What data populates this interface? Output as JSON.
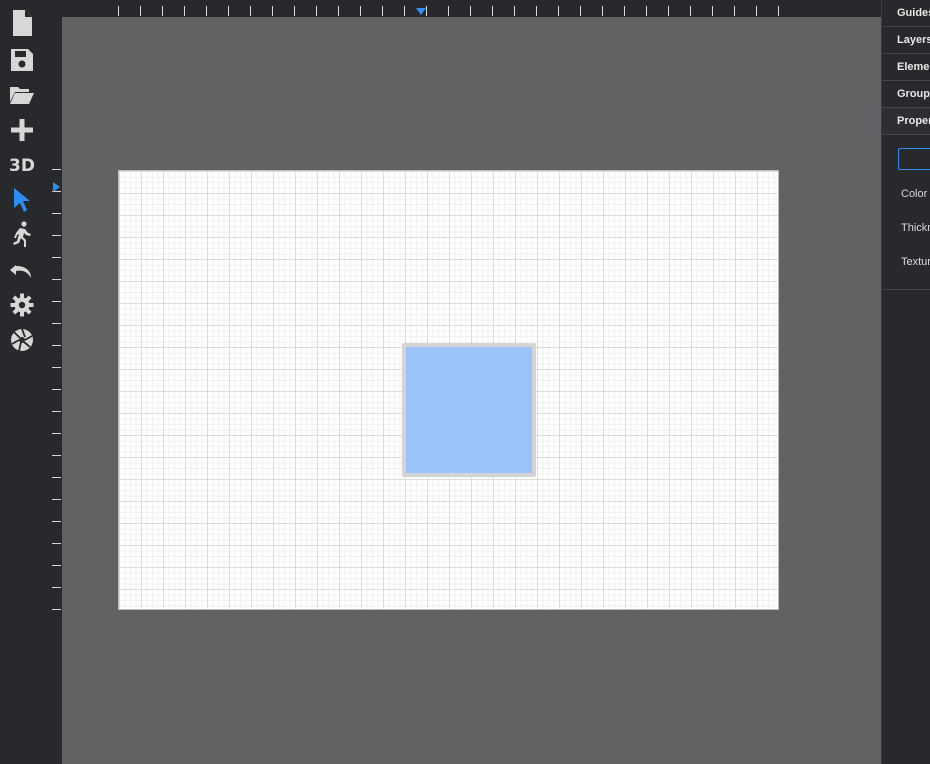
{
  "toolbar": {
    "tools": [
      {
        "name": "new-file-icon",
        "label": ""
      },
      {
        "name": "save-icon",
        "label": ""
      },
      {
        "name": "open-folder-icon",
        "label": ""
      },
      {
        "name": "add-icon",
        "label": ""
      },
      {
        "name": "3d-view-button",
        "label": "3D"
      },
      {
        "name": "select-pointer-icon",
        "label": ""
      },
      {
        "name": "walk-mode-icon",
        "label": ""
      },
      {
        "name": "undo-icon",
        "label": ""
      },
      {
        "name": "settings-gear-icon",
        "label": ""
      },
      {
        "name": "camera-aperture-icon",
        "label": ""
      }
    ],
    "active_tool": "select-pointer-icon",
    "accent_color": "#2d8ef0"
  },
  "canvas": {
    "room": {
      "label": "",
      "fill_color": "#9ac3f8"
    }
  },
  "panel": {
    "sections": {
      "guides": "Guides",
      "layers": "Layers",
      "elements": "Elements",
      "groups": "Groups",
      "properties": "Properties"
    },
    "properties": {
      "name_value": "",
      "color_label": "Color",
      "thickness_label": "Thickness",
      "texture_label": "Texture"
    }
  }
}
